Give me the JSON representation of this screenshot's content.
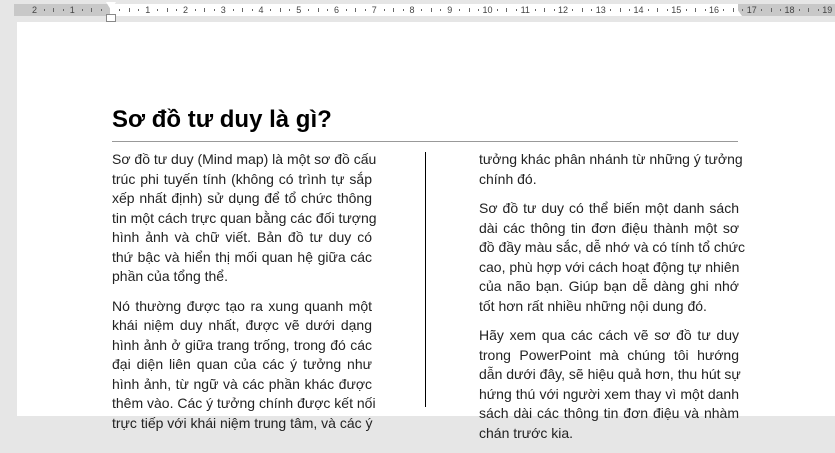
{
  "ruler": {
    "labels": [
      "2",
      "1",
      "",
      "1",
      "2",
      "3",
      "4",
      "5",
      "6",
      "7",
      "8",
      "9",
      "10",
      "11",
      "12",
      "13",
      "14",
      "15",
      "16",
      "17",
      "18",
      "19"
    ]
  },
  "document": {
    "title": "Sơ đồ tư duy là gì?",
    "left_column": [
      [
        "Sơ đồ tư duy (Mind map) là một sơ đồ cấu",
        "trúc phi tuyến tính (không có trình tự sắp",
        "xếp nhất định) sử dụng để tổ chức thông",
        "tin một cách trực quan bằng các đối tượng",
        "hình ảnh và chữ viết. Bản đồ tư duy có",
        "thứ bậc và hiển thị mối quan hệ giữa các",
        "phần của tổng thể."
      ],
      [
        "Nó thường được tạo ra xung quanh một",
        "khái niệm duy nhất, được vẽ dưới dạng",
        "hình ảnh ở giữa trang trống, trong đó các",
        "đại diện liên quan của các ý tưởng như",
        "hình ảnh, từ ngữ và các phần khác được",
        "thêm vào. Các ý tưởng chính được kết nối",
        "trực tiếp với khái niệm trung tâm, và các ý"
      ]
    ],
    "right_column": [
      [
        "tưởng khác phân nhánh từ những ý tưởng",
        "chính đó."
      ],
      [
        "Sơ đồ tư duy có thể biến một danh sách",
        "dài các thông tin đơn điệu thành một sơ",
        "đồ đầy màu sắc, dễ nhớ và có tính tổ chức",
        "cao, phù hợp với cách hoạt động tự nhiên",
        "của não bạn. Giúp bạn dễ dàng ghi nhớ",
        "tốt hơn rất nhiều những nội dung đó."
      ],
      [
        "Hãy xem qua các cách vẽ sơ đồ tư duy",
        "trong PowerPoint mà chúng tôi hướng",
        "dẫn dưới đây, sẽ hiệu quả hơn, thu hút sự",
        "hứng thú với người xem thay vì một danh",
        "sách dài các thông tin đơn điệu và nhàm",
        "chán trước kia."
      ]
    ]
  }
}
